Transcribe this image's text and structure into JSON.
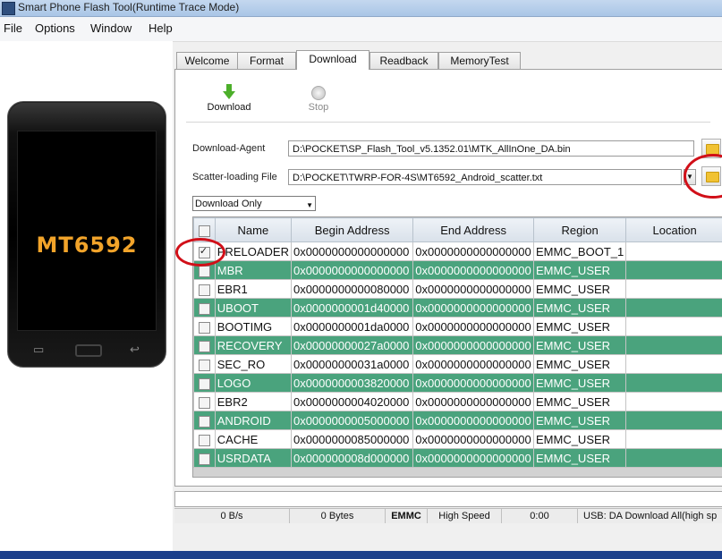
{
  "window": {
    "title": "Smart Phone Flash Tool(Runtime Trace Mode)"
  },
  "menu": [
    "File",
    "Options",
    "Window",
    "Help"
  ],
  "phone": {
    "brand": "MT6592"
  },
  "tabs": [
    {
      "label": "Welcome",
      "active": false
    },
    {
      "label": "Format",
      "active": false
    },
    {
      "label": "Download",
      "active": true
    },
    {
      "label": "Readback",
      "active": false
    },
    {
      "label": "MemoryTest",
      "active": false
    }
  ],
  "toolbar": {
    "download_label": "Download",
    "stop_label": "Stop"
  },
  "fields": {
    "download_agent_label": "Download-Agent",
    "download_agent_value": "D:\\POCKET\\SP_Flash_Tool_v5.1352.01\\MTK_AllInOne_DA.bin",
    "scatter_label": "Scatter-loading File",
    "scatter_value": "D:\\POCKET\\TWRP-FOR-4S\\MT6592_Android_scatter.txt",
    "mode_value": "Download Only"
  },
  "table": {
    "headers": [
      "Name",
      "Begin Address",
      "End Address",
      "Region",
      "Location"
    ],
    "rows": [
      {
        "checked": true,
        "name": "PRELOADER",
        "begin": "0x0000000000000000",
        "end": "0x0000000000000000",
        "region": "EMMC_BOOT_1"
      },
      {
        "checked": false,
        "name": "MBR",
        "begin": "0x0000000000000000",
        "end": "0x0000000000000000",
        "region": "EMMC_USER"
      },
      {
        "checked": false,
        "name": "EBR1",
        "begin": "0x0000000000080000",
        "end": "0x0000000000000000",
        "region": "EMMC_USER"
      },
      {
        "checked": false,
        "name": "UBOOT",
        "begin": "0x0000000001d40000",
        "end": "0x0000000000000000",
        "region": "EMMC_USER"
      },
      {
        "checked": false,
        "name": "BOOTIMG",
        "begin": "0x0000000001da0000",
        "end": "0x0000000000000000",
        "region": "EMMC_USER"
      },
      {
        "checked": false,
        "name": "RECOVERY",
        "begin": "0x00000000027a0000",
        "end": "0x0000000000000000",
        "region": "EMMC_USER"
      },
      {
        "checked": false,
        "name": "SEC_RO",
        "begin": "0x00000000031a0000",
        "end": "0x0000000000000000",
        "region": "EMMC_USER"
      },
      {
        "checked": false,
        "name": "LOGO",
        "begin": "0x0000000003820000",
        "end": "0x0000000000000000",
        "region": "EMMC_USER"
      },
      {
        "checked": false,
        "name": "EBR2",
        "begin": "0x0000000004020000",
        "end": "0x0000000000000000",
        "region": "EMMC_USER"
      },
      {
        "checked": false,
        "name": "ANDROID",
        "begin": "0x0000000005000000",
        "end": "0x0000000000000000",
        "region": "EMMC_USER"
      },
      {
        "checked": false,
        "name": "CACHE",
        "begin": "0x0000000085000000",
        "end": "0x0000000000000000",
        "region": "EMMC_USER"
      },
      {
        "checked": false,
        "name": "USRDATA",
        "begin": "0x000000008d000000",
        "end": "0x0000000000000000",
        "region": "EMMC_USER"
      }
    ]
  },
  "status": {
    "speed": "0 B/s",
    "bytes": "0 Bytes",
    "storage": "EMMC",
    "mode": "High Speed",
    "time": "0:00",
    "usb": "USB: DA Download All(high sp"
  },
  "colors": {
    "row_green": "#4aa37d",
    "annotation_red": "#d10f18",
    "brand_orange": "#f2a42a"
  }
}
